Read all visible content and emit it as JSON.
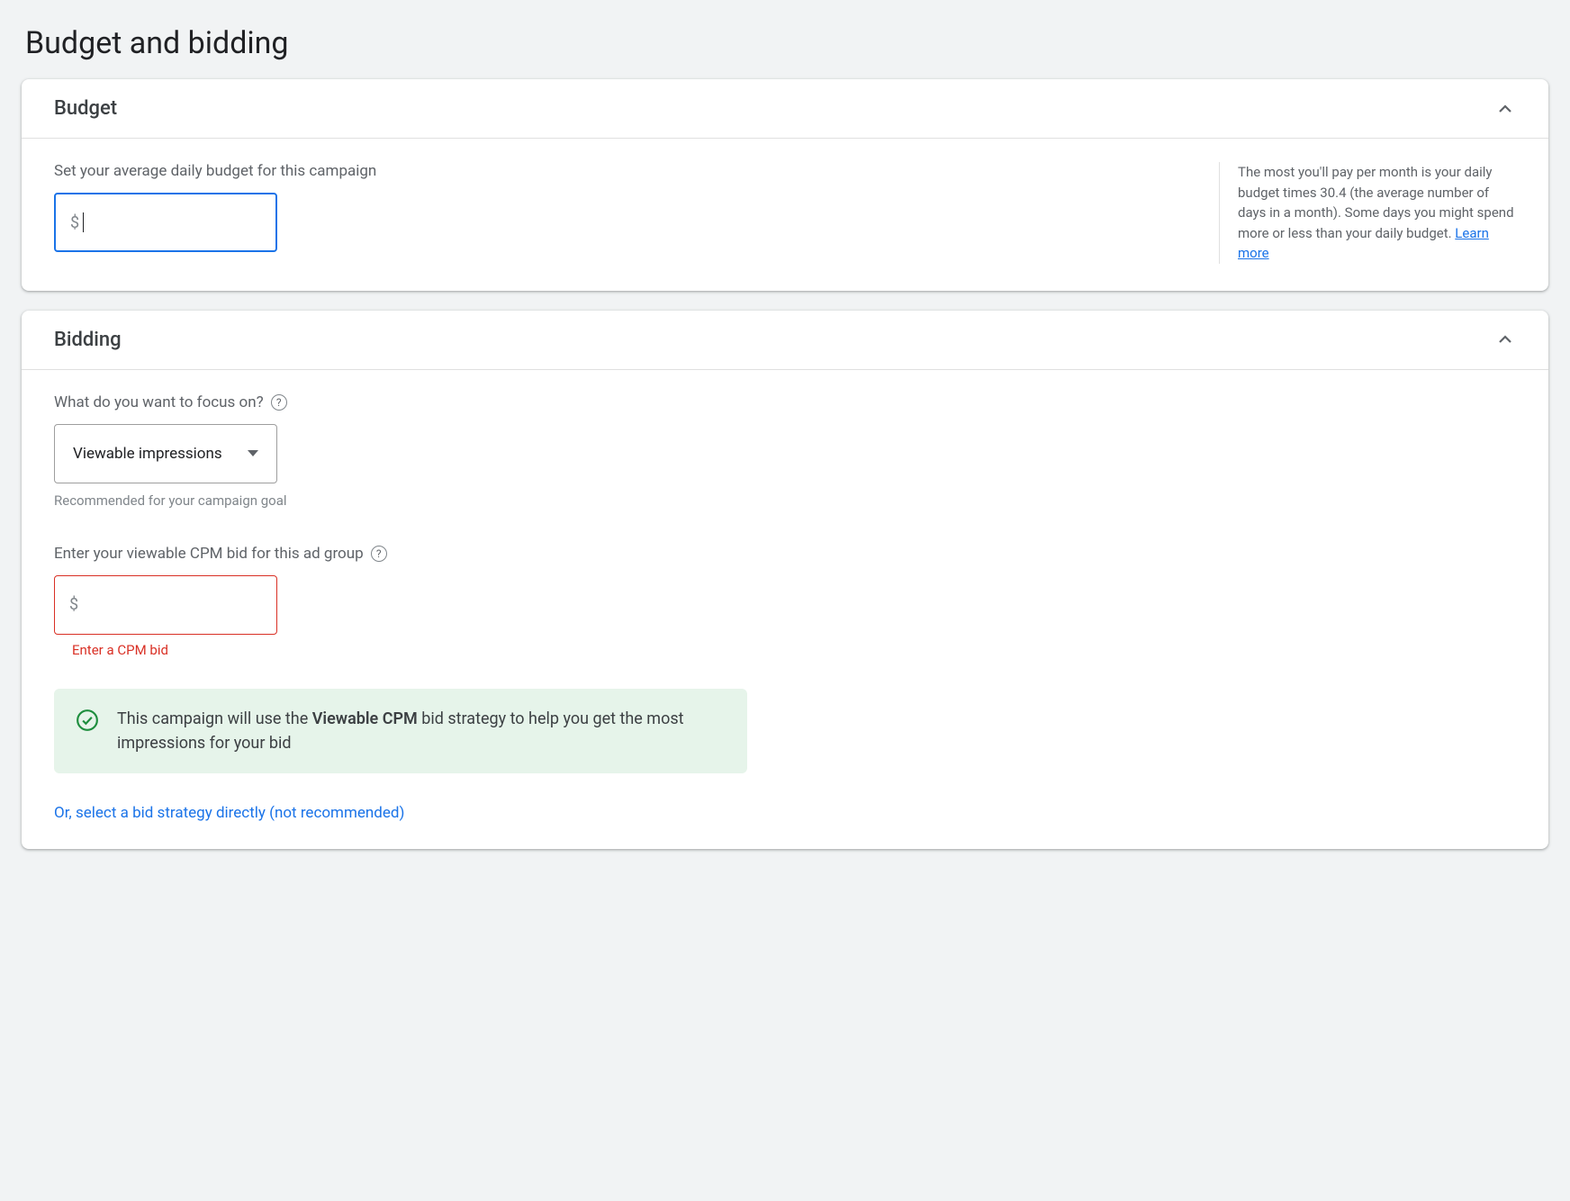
{
  "page": {
    "title": "Budget and bidding"
  },
  "budget": {
    "header": "Budget",
    "label": "Set your average daily budget for this campaign",
    "currency_symbol": "$",
    "value": "",
    "side_text": "The most you'll pay per month is your daily budget times 30.4 (the average number of days in a month). Some days you might spend more or less than your daily budget. ",
    "learn_more": "Learn more"
  },
  "bidding": {
    "header": "Bidding",
    "focus_label": "What do you want to focus on?",
    "focus_selected": "Viewable impressions",
    "focus_helper": "Recommended for your campaign goal",
    "cpm_label": "Enter your viewable CPM bid for this ad group",
    "currency_symbol": "$",
    "cpm_value": "",
    "cpm_error": "Enter a CPM bid",
    "info_prefix": "This campaign will use the ",
    "info_bold": "Viewable CPM",
    "info_suffix": " bid strategy to help you get the most impressions for your bid",
    "alt_link": "Or, select a bid strategy directly (not recommended)"
  }
}
